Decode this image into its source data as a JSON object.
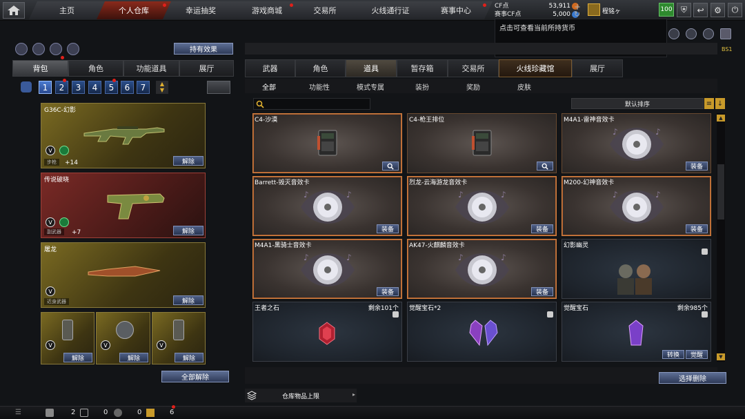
{
  "nav": {
    "tabs": [
      "主页",
      "个人仓库",
      "幸运抽奖",
      "游戏商城",
      "交易所",
      "火线通行证",
      "赛事中心"
    ],
    "active_tab": "个人仓库"
  },
  "currency": {
    "cf_label": "CF点",
    "cf_value": "53,911",
    "match_label": "赛事CF点",
    "match_value": "5,000"
  },
  "user": {
    "name": "程铭ヶ",
    "level": "100"
  },
  "tooltip": "点击可查看当前所持货币",
  "bs_label": "BS1",
  "left": {
    "effects_button": "持有效果",
    "subtabs": [
      "背包",
      "角色",
      "功能道具",
      "展厅"
    ],
    "active_subtab": "背包",
    "pages": [
      "1",
      "2",
      "3",
      "4",
      "5",
      "6",
      "7"
    ],
    "active_page": "1",
    "slots": [
      {
        "title": "G36C-幻影",
        "tag": "步枪",
        "plus": "+14",
        "button": "解除"
      },
      {
        "title": "传说破晓",
        "tag": "副武器",
        "plus": "+7",
        "button": "解除"
      },
      {
        "title": "屠龙",
        "tag": "近身武器",
        "button": "解除"
      }
    ],
    "small_slots": [
      {
        "button": "解除"
      },
      {
        "button": "解除"
      },
      {
        "button": "解除"
      }
    ],
    "unequip_all": "全部解除"
  },
  "right": {
    "tabs": [
      "武器",
      "角色",
      "道具",
      "暂存箱",
      "交易所",
      "火线珍藏馆",
      "展厅"
    ],
    "active_tab": "道具",
    "categories": [
      "全部",
      "功能性",
      "模式专属",
      "装扮",
      "奖励",
      "皮肤"
    ],
    "active_category": "全部",
    "sort_label": "默认排序",
    "items": [
      {
        "title": "C4-沙漠",
        "kind": "c4",
        "button": "",
        "style": "hl"
      },
      {
        "title": "C4-枪王排位",
        "kind": "c4",
        "button": "",
        "style": "normal"
      },
      {
        "title": "M4A1-雷神音效卡",
        "kind": "disc",
        "button": "装备",
        "style": "normal"
      },
      {
        "title": "Barrett-毁灭音效卡",
        "kind": "disc",
        "button": "装备",
        "style": "hl"
      },
      {
        "title": "烈龙-云海游龙音效卡",
        "kind": "disc",
        "button": "装备",
        "style": "hl"
      },
      {
        "title": "M200-幻神音效卡",
        "kind": "disc",
        "button": "装备",
        "style": "hl"
      },
      {
        "title": "M4A1-黑骑士音效卡",
        "kind": "disc",
        "button": "装备",
        "style": "hl"
      },
      {
        "title": "AK47-火麒麟音效卡",
        "kind": "disc",
        "button": "装备",
        "style": "hl"
      },
      {
        "title": "幻影幽灵",
        "kind": "char",
        "button": "",
        "style": "dark"
      },
      {
        "title": "王者之石",
        "kind": "redgem",
        "count": "剩余101个",
        "button": "",
        "style": "dark"
      },
      {
        "title": "觉醒宝石*2",
        "kind": "purplegem2",
        "button": "",
        "style": "dark"
      },
      {
        "title": "觉醒宝石",
        "kind": "purplegem",
        "count": "剩余985个",
        "button": "觉醒",
        "button2": "转换",
        "style": "dark"
      }
    ],
    "multi_delete": "选择删除",
    "capacity": "仓库物品上限"
  },
  "statusbar": {
    "count1": "2",
    "count2": "0",
    "count3": "0",
    "count4": "6"
  },
  "colors": {
    "accent_red": "#8a2a1c",
    "button_blue": "#4e5f86",
    "gold": "#c89a2a",
    "level_green": "#2e8a2e"
  }
}
